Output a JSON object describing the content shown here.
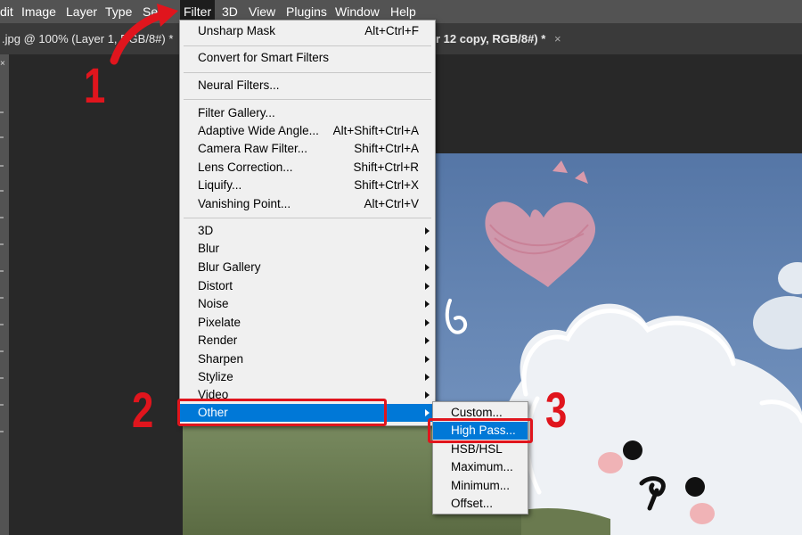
{
  "menubar": {
    "items": [
      "dit",
      "Image",
      "Layer",
      "Type",
      "Sel",
      "Filter",
      "3D",
      "View",
      "Plugins",
      "Window",
      "Help"
    ]
  },
  "tabs": {
    "left_tab": ".jpg @ 100% (Layer 1, RGB/8#) *",
    "right_tab": "r 12 copy, RGB/8#) *",
    "close_glyph": "×"
  },
  "toolstrip": {
    "close_glyph": "×"
  },
  "filter_menu": {
    "unsharp_mask": {
      "label": "Unsharp Mask",
      "shortcut": "Alt+Ctrl+F"
    },
    "convert_smart": {
      "label": "Convert for Smart Filters"
    },
    "neural_filters": {
      "label": "Neural Filters..."
    },
    "filter_gallery": {
      "label": "Filter Gallery..."
    },
    "adaptive_wide_angle": {
      "label": "Adaptive Wide Angle...",
      "shortcut": "Alt+Shift+Ctrl+A"
    },
    "camera_raw": {
      "label": "Camera Raw Filter...",
      "shortcut": "Shift+Ctrl+A"
    },
    "lens_correction": {
      "label": "Lens Correction...",
      "shortcut": "Shift+Ctrl+R"
    },
    "liquify": {
      "label": "Liquify...",
      "shortcut": "Shift+Ctrl+X"
    },
    "vanishing_point": {
      "label": "Vanishing Point...",
      "shortcut": "Alt+Ctrl+V"
    },
    "submenus": [
      "3D",
      "Blur",
      "Blur Gallery",
      "Distort",
      "Noise",
      "Pixelate",
      "Render",
      "Sharpen",
      "Stylize",
      "Video",
      "Other"
    ],
    "highlighted": "Other"
  },
  "other_submenu": {
    "items": [
      "Custom...",
      "High Pass...",
      "HSB/HSL",
      "Maximum...",
      "Minimum...",
      "Offset..."
    ],
    "highlighted": "High Pass..."
  },
  "annotations": {
    "step1": "1",
    "step2": "2",
    "step3": "3"
  },
  "colors": {
    "menubar": "#535353",
    "tabbar": "#3a3a3a",
    "workspace": "#282828",
    "menu_bg": "#f0f0f0",
    "highlight": "#0078d7",
    "annotation_red": "#e0151d",
    "sky": "#5d7fae"
  }
}
